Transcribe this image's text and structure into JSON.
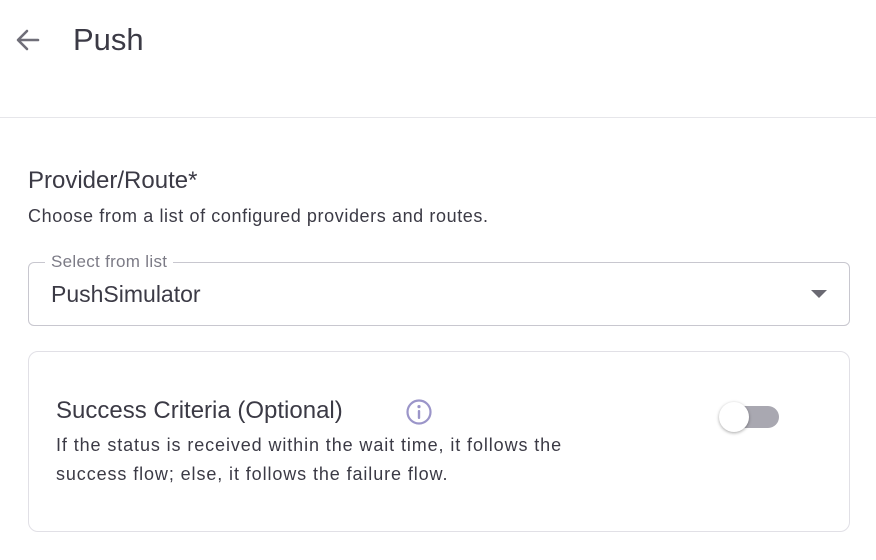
{
  "header": {
    "back_icon": "arrow-left-icon",
    "title": "Push"
  },
  "provider": {
    "title": "Provider/Route*",
    "description": "Choose from a list of configured providers and routes.",
    "select": {
      "label": "Select from list",
      "value": "PushSimulator",
      "icon": "caret-down-icon"
    }
  },
  "success_criteria": {
    "title": "Success Criteria (Optional)",
    "info_icon": "info-icon",
    "description_line1": "If the status is received within the wait time, it follows the",
    "description_line2": "success flow; else, it follows the failure flow.",
    "toggle_enabled": false
  },
  "colors": {
    "text": "#3b3a45",
    "muted": "#7c7b86",
    "border": "#c8c7cf",
    "toggle_track": "#a9a8b1",
    "info_icon": "#9b95c9"
  }
}
